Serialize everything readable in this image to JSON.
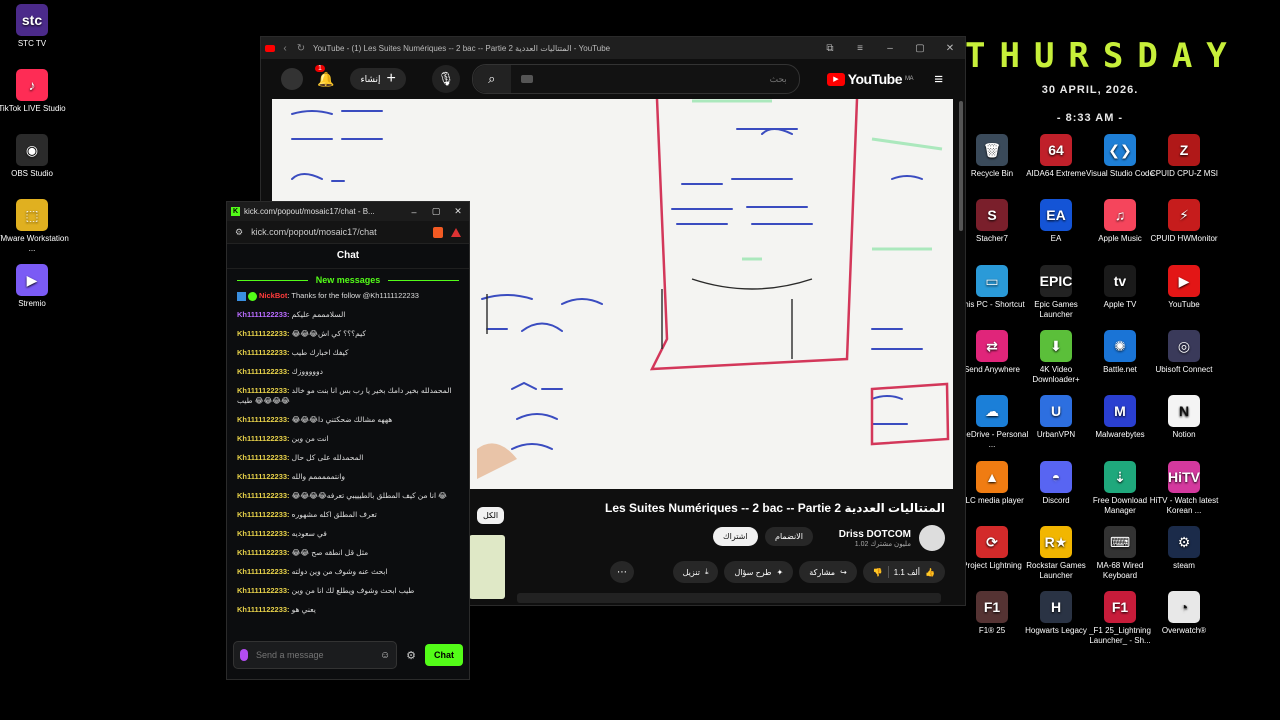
{
  "desktop": {
    "left_icons": [
      {
        "label": "STC TV",
        "icon": "stc-tv-icon",
        "color": "#4b2a8a",
        "glyph": "stc"
      },
      {
        "label": "TikTok LIVE Studio",
        "icon": "tiktok-live-studio-icon",
        "color": "#fe2c55",
        "glyph": "♪"
      },
      {
        "label": "OBS Studio",
        "icon": "obs-studio-icon",
        "color": "#2b2b2b",
        "glyph": "◉"
      },
      {
        "label": "VMware Workstation ...",
        "icon": "vmware-workstation-icon",
        "color": "#e0b020",
        "glyph": "⬚"
      },
      {
        "label": "Stremio",
        "icon": "stremio-icon",
        "color": "#7b5bf5",
        "glyph": "▶"
      }
    ],
    "right_icons": [
      {
        "label": "Recycle Bin",
        "icon": "recycle-bin-icon",
        "color": "#3a4a5a",
        "glyph": "🗑"
      },
      {
        "label": "AIDA64 Extreme",
        "icon": "aida64-extreme-icon",
        "color": "#c0202a",
        "glyph": "64"
      },
      {
        "label": "Visual Studio Code",
        "icon": "visual-studio-code-icon",
        "color": "#1e7fd6",
        "glyph": "❮❯"
      },
      {
        "label": "CPUID CPU-Z MSI",
        "icon": "cpuz-msi-icon",
        "color": "#b01818",
        "glyph": "Z"
      },
      {
        "label": "Stacher7",
        "icon": "stacher7-icon",
        "color": "#7a1f2b",
        "glyph": "S"
      },
      {
        "label": "EA",
        "icon": "ea-icon",
        "color": "#1454d6",
        "glyph": "EA"
      },
      {
        "label": "Apple Music",
        "icon": "apple-music-icon",
        "color": "#f5455c",
        "glyph": "♫"
      },
      {
        "label": "CPUID HWMonitor",
        "icon": "hwmonitor-icon",
        "color": "#c61c1c",
        "glyph": "⚡"
      },
      {
        "label": "This PC - Shortcut",
        "icon": "this-pc-icon",
        "color": "#2a9ad8",
        "glyph": "▭"
      },
      {
        "label": "Epic Games Launcher",
        "icon": "epic-games-icon",
        "color": "#222222",
        "glyph": "EPIC"
      },
      {
        "label": "Apple TV",
        "icon": "apple-tv-icon",
        "color": "#1a1a1a",
        "glyph": "tv"
      },
      {
        "label": "YouTube",
        "icon": "youtube-icon",
        "color": "#e31616",
        "glyph": "▶"
      },
      {
        "label": "Send Anywhere",
        "icon": "send-anywhere-icon",
        "color": "#e0257a",
        "glyph": "⇄"
      },
      {
        "label": "4K Video Downloader+",
        "icon": "4k-video-downloader-icon",
        "color": "#5bbf3a",
        "glyph": "⬇"
      },
      {
        "label": "Battle.net",
        "icon": "battle-net-icon",
        "color": "#1a74d6",
        "glyph": "✺"
      },
      {
        "label": "Ubisoft Connect",
        "icon": "ubisoft-connect-icon",
        "color": "#3a3a5a",
        "glyph": "◎"
      },
      {
        "label": "OneDrive - Personal ...",
        "icon": "onedrive-icon",
        "color": "#1b7fd8",
        "glyph": "☁"
      },
      {
        "label": "UrbanVPN",
        "icon": "urbanvpn-icon",
        "color": "#2d6fe0",
        "glyph": "U"
      },
      {
        "label": "Malwarebytes",
        "icon": "malwarebytes-icon",
        "color": "#2a3fd0",
        "glyph": "M"
      },
      {
        "label": "Notion",
        "icon": "notion-icon",
        "color": "#f4f4f4",
        "glyph": "N"
      },
      {
        "label": "VLC media player",
        "icon": "vlc-icon",
        "color": "#f07c12",
        "glyph": "▲"
      },
      {
        "label": "Discord",
        "icon": "discord-icon",
        "color": "#5865f2",
        "glyph": "◓"
      },
      {
        "label": "Free Download Manager",
        "icon": "free-download-manager-icon",
        "color": "#1fa87c",
        "glyph": "⇣"
      },
      {
        "label": "HiTV - Watch latest Korean ...",
        "icon": "hitv-icon",
        "color": "#d4399e",
        "glyph": "HiTV"
      },
      {
        "label": "Project Lightning",
        "icon": "project-lightning-icon",
        "color": "#d32a2a",
        "glyph": "⟳"
      },
      {
        "label": "Rockstar Games Launcher",
        "icon": "rockstar-games-icon",
        "color": "#f2b600",
        "glyph": "R★"
      },
      {
        "label": "MA-68 Wired Keyboard",
        "icon": "keyboard-icon",
        "color": "#333333",
        "glyph": "⌨"
      },
      {
        "label": "steam",
        "icon": "steam-icon",
        "color": "#1b2b4a",
        "glyph": "⚙"
      },
      {
        "label": "F1® 25",
        "icon": "f1-25-icon",
        "color": "#553333",
        "glyph": "F1"
      },
      {
        "label": "Hogwarts Legacy",
        "icon": "hogwarts-legacy-icon",
        "color": "#2a3344",
        "glyph": "H"
      },
      {
        "label": "_F1 25_Lightning Launcher_ - Sh...",
        "icon": "f1-lightning-launcher-icon",
        "color": "#c71c3a",
        "glyph": "F1"
      },
      {
        "label": "Overwatch®",
        "icon": "overwatch-icon",
        "color": "#e8e8e8",
        "glyph": "◔"
      }
    ],
    "widget": {
      "weekday": "THURSDAY",
      "date": "30 APRIL, 2026.",
      "time": "- 8:33 AM -"
    }
  },
  "browser": {
    "tab_title": "YouTube - (1) Les Suites Numériques -- 2 bac -- Partie 2 المتتاليات العددية - YouTube",
    "notif_count": "1",
    "create_label": "إنشاء",
    "search_placeholder": "بحث",
    "logo_text": "YouTube",
    "logo_region": "MA",
    "video_title": "Les Suites Numériques -- 2 bac -- Partie 2 المتتاليات العددية",
    "channel_name": "Driss DOTCOM",
    "subscribers": "1.02 مليون مشترك",
    "join_label": "الانضمام",
    "subscribe_label": "اشتراك",
    "like_count": "1.1 ألف",
    "share_label": "مشاركة",
    "ask_label": "طرح سؤال",
    "download_label": "تنزيل",
    "all_chip": "الكل"
  },
  "chat": {
    "window_title": "kick.com/popout/mosaic17/chat - B...",
    "url": "kick.com/popout/mosaic17/chat",
    "header": "Chat",
    "new_messages": "New messages",
    "messages": [
      {
        "user": "NickBot",
        "text": "Thanks for the follow @Kh1111122233",
        "style": "red"
      },
      {
        "user": "Kh1111122233:",
        "text": "السلامممم عليكم",
        "style": "purple"
      },
      {
        "user": "Kh1111122233:",
        "text": "😂😂😂كيم؟؟؟ كي اش",
        "style": ""
      },
      {
        "user": "Kh1111122233:",
        "text": "كيفك اخبارك طيب",
        "style": ""
      },
      {
        "user": "Kh1111122233:",
        "text": "دوووووزك",
        "style": ""
      },
      {
        "user": "Kh1111122233:",
        "text": "المحمدلله بخير دامك بخير يا رب بس انا بنت مو خالد طيب 😂😂😂😂",
        "style": ""
      },
      {
        "user": "Kh1111122233:",
        "text": "😂😂😂هههه مشالك ضحكتني دا",
        "style": ""
      },
      {
        "user": "Kh1111122233:",
        "text": "انت من وين",
        "style": ""
      },
      {
        "user": "Kh1111122233:",
        "text": "المحمدلله على كل حال",
        "style": ""
      },
      {
        "user": "Kh1111122233:",
        "text": "وانتمممممم والله",
        "style": ""
      },
      {
        "user": "Kh1111122233:",
        "text": "😂😂😂😂انا من كيف المطلق بالطيييبي تعرفه 😂",
        "style": ""
      },
      {
        "user": "Kh1111122233:",
        "text": "تعرف المطلق اكله مشهوره",
        "style": ""
      },
      {
        "user": "Kh1111122233:",
        "text": "في سعوديه",
        "style": ""
      },
      {
        "user": "Kh1111122233:",
        "text": "😂😂 مثل قل انطقه صح",
        "style": ""
      },
      {
        "user": "Kh1111122233:",
        "text": "ابحث عنه وشوف من وين دولته",
        "style": ""
      },
      {
        "user": "Kh1111122233:",
        "text": "طيب ابحث وشوف ويطلع لك انا من وين",
        "style": ""
      },
      {
        "user": "Kh1111122233:",
        "text": "يعني هو",
        "style": ""
      }
    ],
    "input_placeholder": "Send a message",
    "send_label": "Chat"
  }
}
